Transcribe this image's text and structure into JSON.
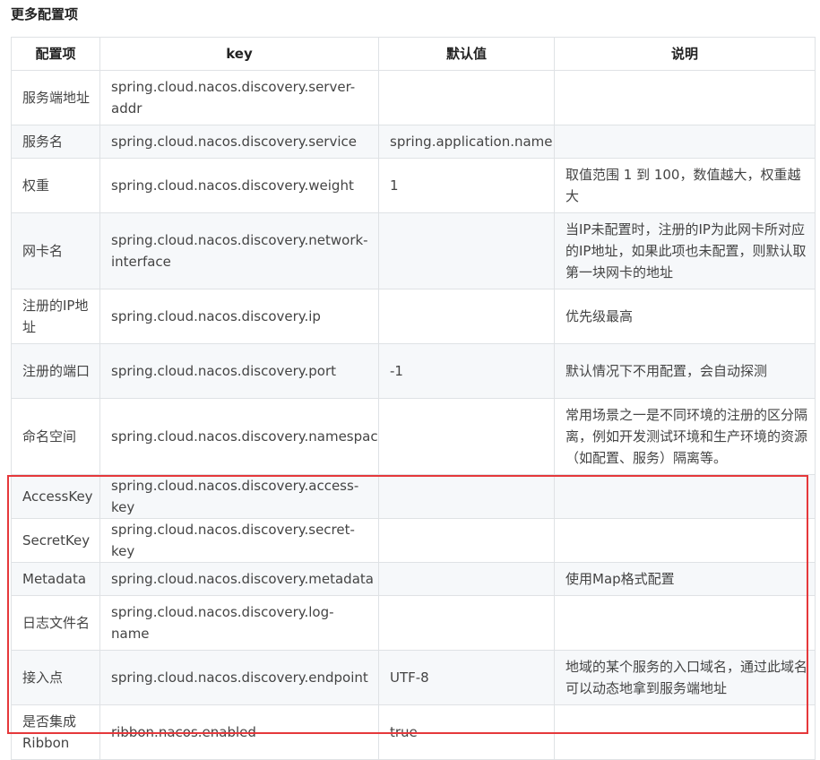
{
  "heading": "更多配置项",
  "table": {
    "headers": [
      "配置项",
      "key",
      "默认值",
      "说明"
    ],
    "rows": [
      {
        "name": "服务端地址",
        "key": "spring.cloud.nacos.discovery.server-addr",
        "default": "",
        "desc": ""
      },
      {
        "name": "服务名",
        "key": "spring.cloud.nacos.discovery.service",
        "default": "spring.application.name",
        "desc": ""
      },
      {
        "name": "权重",
        "key": "spring.cloud.nacos.discovery.weight",
        "default": "1",
        "desc": "取值范围 1 到 100，数值越大，权重越大"
      },
      {
        "name": "网卡名",
        "key": "spring.cloud.nacos.discovery.network-interface",
        "default": "",
        "desc": "当IP未配置时，注册的IP为此网卡所对应的IP地址，如果此项也未配置，则默认取第一块网卡的地址"
      },
      {
        "name": "注册的IP地址",
        "key": "spring.cloud.nacos.discovery.ip",
        "default": "",
        "desc": "优先级最高"
      },
      {
        "name": "注册的端口",
        "key": "spring.cloud.nacos.discovery.port",
        "default": "-1",
        "desc": "默认情况下不用配置，会自动探测"
      },
      {
        "name": "命名空间",
        "key": "spring.cloud.nacos.discovery.namespace",
        "default": "",
        "desc": "常用场景之一是不同环境的注册的区分隔离，例如开发测试环境和生产环境的资源（如配置、服务）隔离等。"
      },
      {
        "name": "AccessKey",
        "key": "spring.cloud.nacos.discovery.access-key",
        "default": "",
        "desc": ""
      },
      {
        "name": "SecretKey",
        "key": "spring.cloud.nacos.discovery.secret-key",
        "default": "",
        "desc": ""
      },
      {
        "name": "Metadata",
        "key": "spring.cloud.nacos.discovery.metadata",
        "default": "",
        "desc": "使用Map格式配置"
      },
      {
        "name": "日志文件名",
        "key": "spring.cloud.nacos.discovery.log-name",
        "default": "",
        "desc": ""
      },
      {
        "name": "接入点",
        "key": "spring.cloud.nacos.discovery.endpoint",
        "default": "UTF-8",
        "desc": "地域的某个服务的入口域名，通过此域名可以动态地拿到服务端地址"
      },
      {
        "name": "是否集成Ribbon",
        "key": "ribbon.nacos.enabled",
        "default": "true",
        "desc": ""
      }
    ]
  },
  "colors": {
    "highlight": "#e5383b",
    "border": "#dfe2e5",
    "stripe": "#f6f8fa"
  }
}
